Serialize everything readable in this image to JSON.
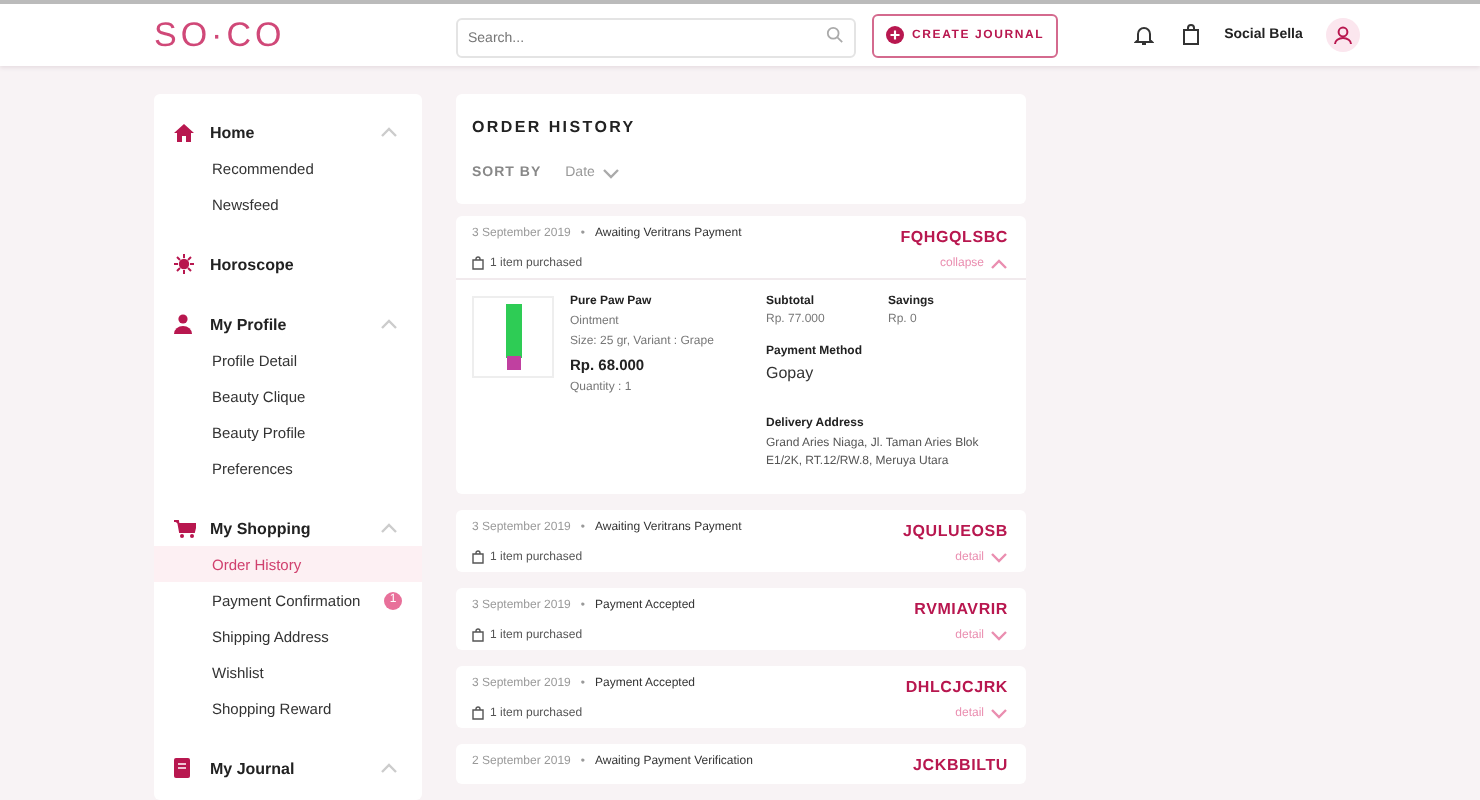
{
  "header": {
    "logo": "SO·CO",
    "search": {
      "placeholder": "Search..."
    },
    "create_button": "CREATE JOURNAL",
    "user_name": "Social Bella"
  },
  "sidebar": {
    "sections": [
      {
        "label": "Home",
        "kind": "group",
        "expanded": true,
        "items": [
          {
            "label": "Recommended",
            "selected": false
          },
          {
            "label": "Newsfeed",
            "selected": false
          }
        ]
      },
      {
        "label": "Horoscope",
        "kind": "link"
      },
      {
        "label": "My Profile",
        "kind": "group",
        "expanded": true,
        "items": [
          {
            "label": "Profile Detail",
            "selected": false
          },
          {
            "label": "Beauty Clique",
            "selected": false
          },
          {
            "label": "Beauty Profile",
            "selected": false
          },
          {
            "label": "Preferences",
            "selected": false
          }
        ]
      },
      {
        "label": "My Shopping",
        "kind": "group",
        "expanded": true,
        "items": [
          {
            "label": "Order History",
            "selected": true
          },
          {
            "label": "Payment Confirmation",
            "selected": false,
            "badge": "1"
          },
          {
            "label": "Shipping Address",
            "selected": false
          },
          {
            "label": "Wishlist",
            "selected": false
          },
          {
            "label": "Shopping Reward",
            "selected": false
          }
        ]
      },
      {
        "label": "My Journal",
        "kind": "group",
        "expanded": true
      }
    ]
  },
  "order_history": {
    "title": "ORDER HISTORY",
    "sort_label": "SORT BY",
    "sort_value": "Date",
    "orders": [
      {
        "date": "3 September 2019",
        "separator": "•",
        "status": "Awaiting Veritrans Payment",
        "code": "FQHGQLSBC",
        "items_text": "1 item purchased",
        "toggle": "collapse",
        "expanded": true,
        "detail": {
          "product_name": "Pure Paw Paw",
          "product_type": "Ointment",
          "product_size": "Size: 25 gr, Variant : Grape",
          "price": "Rp. 68.000",
          "quantity": "Quantity : 1",
          "subtotal_label": "Subtotal",
          "subtotal": "Rp. 77.000",
          "savings_label": "Savings",
          "savings": "Rp. 0",
          "payment_label": "Payment Method",
          "payment": "Gopay",
          "address_label": "Delivery Address",
          "address": "Grand Aries Niaga, Jl. Taman Aries Blok E1/2K, RT.12/RW.8, Meruya Utara"
        }
      },
      {
        "date": "3 September 2019",
        "separator": "•",
        "status": "Awaiting Veritrans Payment",
        "code": "JQULUEOSB",
        "items_text": "1 item purchased",
        "toggle": "detail",
        "expanded": false
      },
      {
        "date": "3 September 2019",
        "separator": "•",
        "status": "Payment Accepted",
        "code": "RVMIAVRIR",
        "items_text": "1 item purchased",
        "toggle": "detail",
        "expanded": false
      },
      {
        "date": "3 September 2019",
        "separator": "•",
        "status": "Payment Accepted",
        "code": "DHLCJCJRK",
        "items_text": "1 item purchased",
        "toggle": "detail",
        "expanded": false
      },
      {
        "date": "2 September 2019",
        "separator": "•",
        "status": "Awaiting Payment Verification",
        "code": "JCKBBILTU"
      }
    ]
  }
}
